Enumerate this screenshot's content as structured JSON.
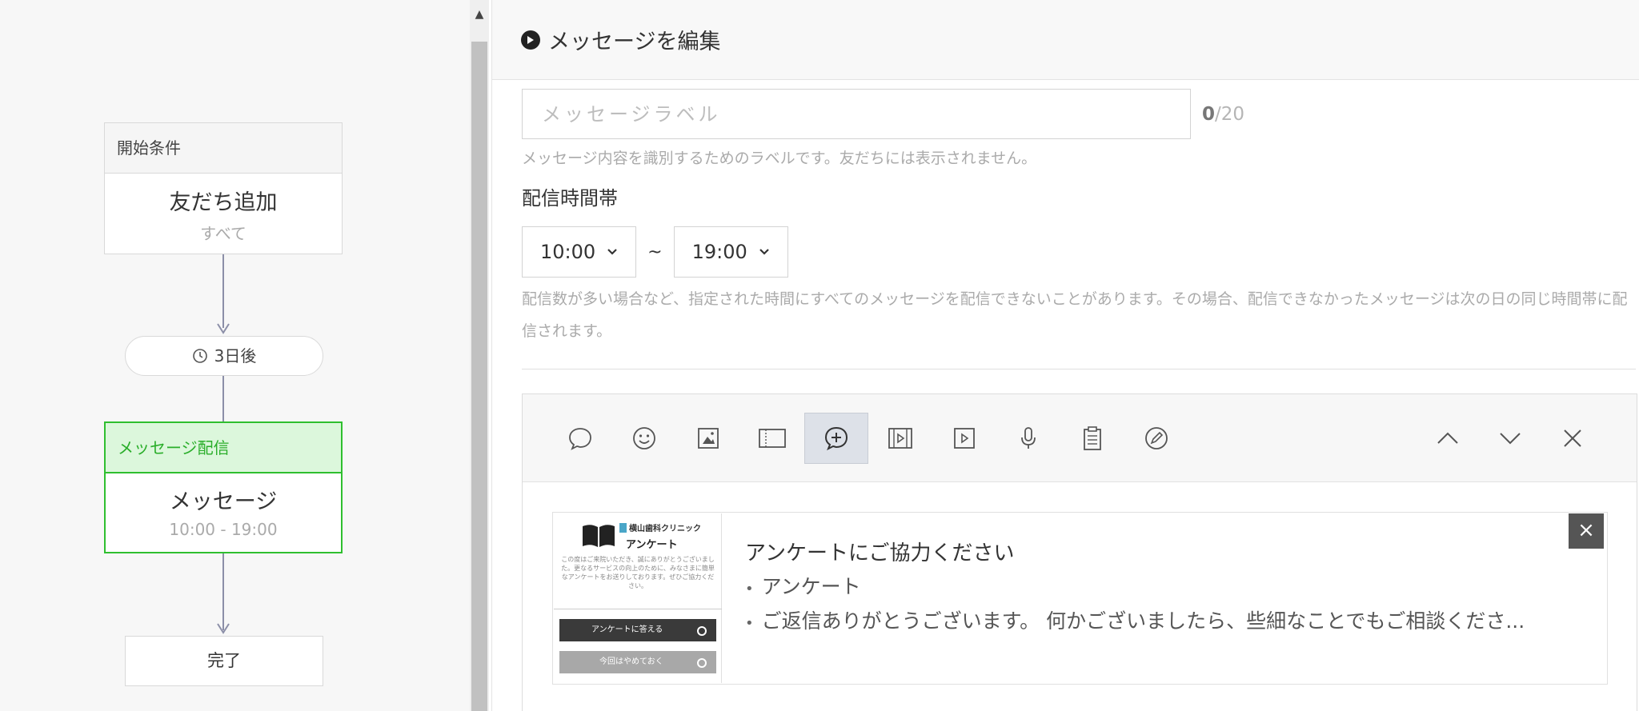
{
  "flow": {
    "start_node": {
      "header": "開始条件",
      "title": "友だち追加",
      "subtitle": "すべて"
    },
    "delay": {
      "label": "3日後"
    },
    "message_node": {
      "header": "メッセージ配信",
      "title": "メッセージ",
      "subtitle": "10:00 - 19:00"
    },
    "end_node": {
      "label": "完了"
    }
  },
  "editor": {
    "header_title": "メッセージを編集",
    "label_placeholder": "メッセージラベル",
    "label_value": "",
    "counter_current": "0",
    "counter_max": "/20",
    "label_hint": "メッセージ内容を識別するためのラベルです。友だちには表示されません。",
    "delivery_title": "配信時間帯",
    "time_start": "10:00",
    "time_end": "19:00",
    "tilde": "~",
    "delivery_hint": "配信数が多い場合など、指定された時間にすべてのメッセージを配信できないことがあります。その場合、配信できなかったメッセージは次の日の同じ時間帯に配信されます。",
    "toolbar_icons": [
      "text-bubble-icon",
      "emoji-icon",
      "image-icon",
      "card-icon",
      "survey-icon",
      "video-card-icon",
      "video-icon",
      "microphone-icon",
      "clipboard-icon",
      "sticker-icon"
    ],
    "active_tool": "survey-icon",
    "card": {
      "thumbnail": {
        "clinic": "横山歯科クリニック",
        "title": "アンケート",
        "body": "この度はご来院いただき、誠にありがとうございました。更なるサービスの向上のために、みなさまに簡単なアンケートをお送りしております。ぜひご協力ください。",
        "button_answer": "アンケートに答える",
        "button_skip": "今回はやめておく"
      },
      "title": "アンケートにご協力ください",
      "items": [
        "アンケート",
        "ご返信ありがとうございます。 何かございましたら、些細なことでもご相談くださ..."
      ],
      "bullet": "•",
      "close": "×"
    }
  }
}
